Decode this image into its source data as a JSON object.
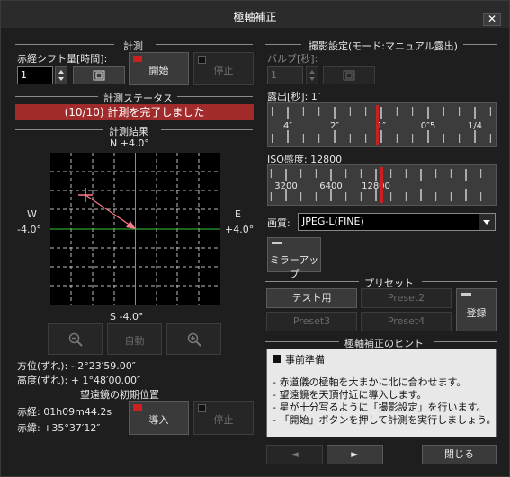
{
  "window": {
    "title": "極軸補正",
    "close": "✕"
  },
  "measure": {
    "header": "計測",
    "ra_shift_label": "赤経シフト量[時間]:",
    "ra_shift_value": "1",
    "start_label": "開始",
    "stop_label": "停止"
  },
  "status": {
    "header": "計測ステータス",
    "text": "(10/10) 計測を完了しました"
  },
  "result": {
    "header": "計測結果",
    "north": "N  +4.0°",
    "south": "S  -4.0°",
    "west": "W",
    "west_val": "-4.0°",
    "east": "E",
    "east_val": "+4.0°",
    "auto_label": "自動",
    "azimuth": "方位(ずれ):  - 2°23′59.00″",
    "altitude": "高度(ずれ):  + 1°48′00.00″"
  },
  "scope": {
    "header": "望遠鏡の初期位置",
    "ra": "赤経:  01h09m44.2s",
    "dec": "赤緯:  +35°37′12″",
    "import_label": "導入",
    "stop_label": "停止"
  },
  "shooting": {
    "header": "撮影設定(モード:マニュアル露出)",
    "bulb_label": "バルブ[秒]:",
    "bulb_value": "1",
    "exposure_label": "露出[秒]: 1″",
    "exposure_ticks": [
      "4″",
      "2″",
      "1″",
      "0″5",
      "1/4"
    ],
    "exposure_position": 0.48,
    "iso_label": "ISO感度: 12800",
    "iso_ticks": [
      "3200",
      "6400",
      "12800"
    ],
    "iso_position": 0.5,
    "quality_label": "画質:",
    "quality_value": "JPEG-L(FINE)",
    "mirror_label": "ミラーアップ"
  },
  "preset": {
    "header": "プリセット",
    "test": "テスト用",
    "p2": "Preset2",
    "p3": "Preset3",
    "p4": "Preset4",
    "register": "登録"
  },
  "hint": {
    "header": "極軸補正のヒント",
    "title": "事前準備",
    "lines": [
      "- 赤道儀の極軸を大まかに北に合わせます。",
      "- 望遠鏡を天頂付近に導入します。",
      "- 星が十分写るように「撮影設定」を行います。",
      "- 「開始」ボタンを押して計測を実行しましょう。"
    ]
  },
  "nav": {
    "prev": "◄",
    "next": "►",
    "close": "閉じる"
  },
  "colors": {
    "accent_red": "#cc2020",
    "status_bg": "#a12a2a",
    "grid_green": "#39c639",
    "arrow_pink": "#ff7a8a"
  }
}
